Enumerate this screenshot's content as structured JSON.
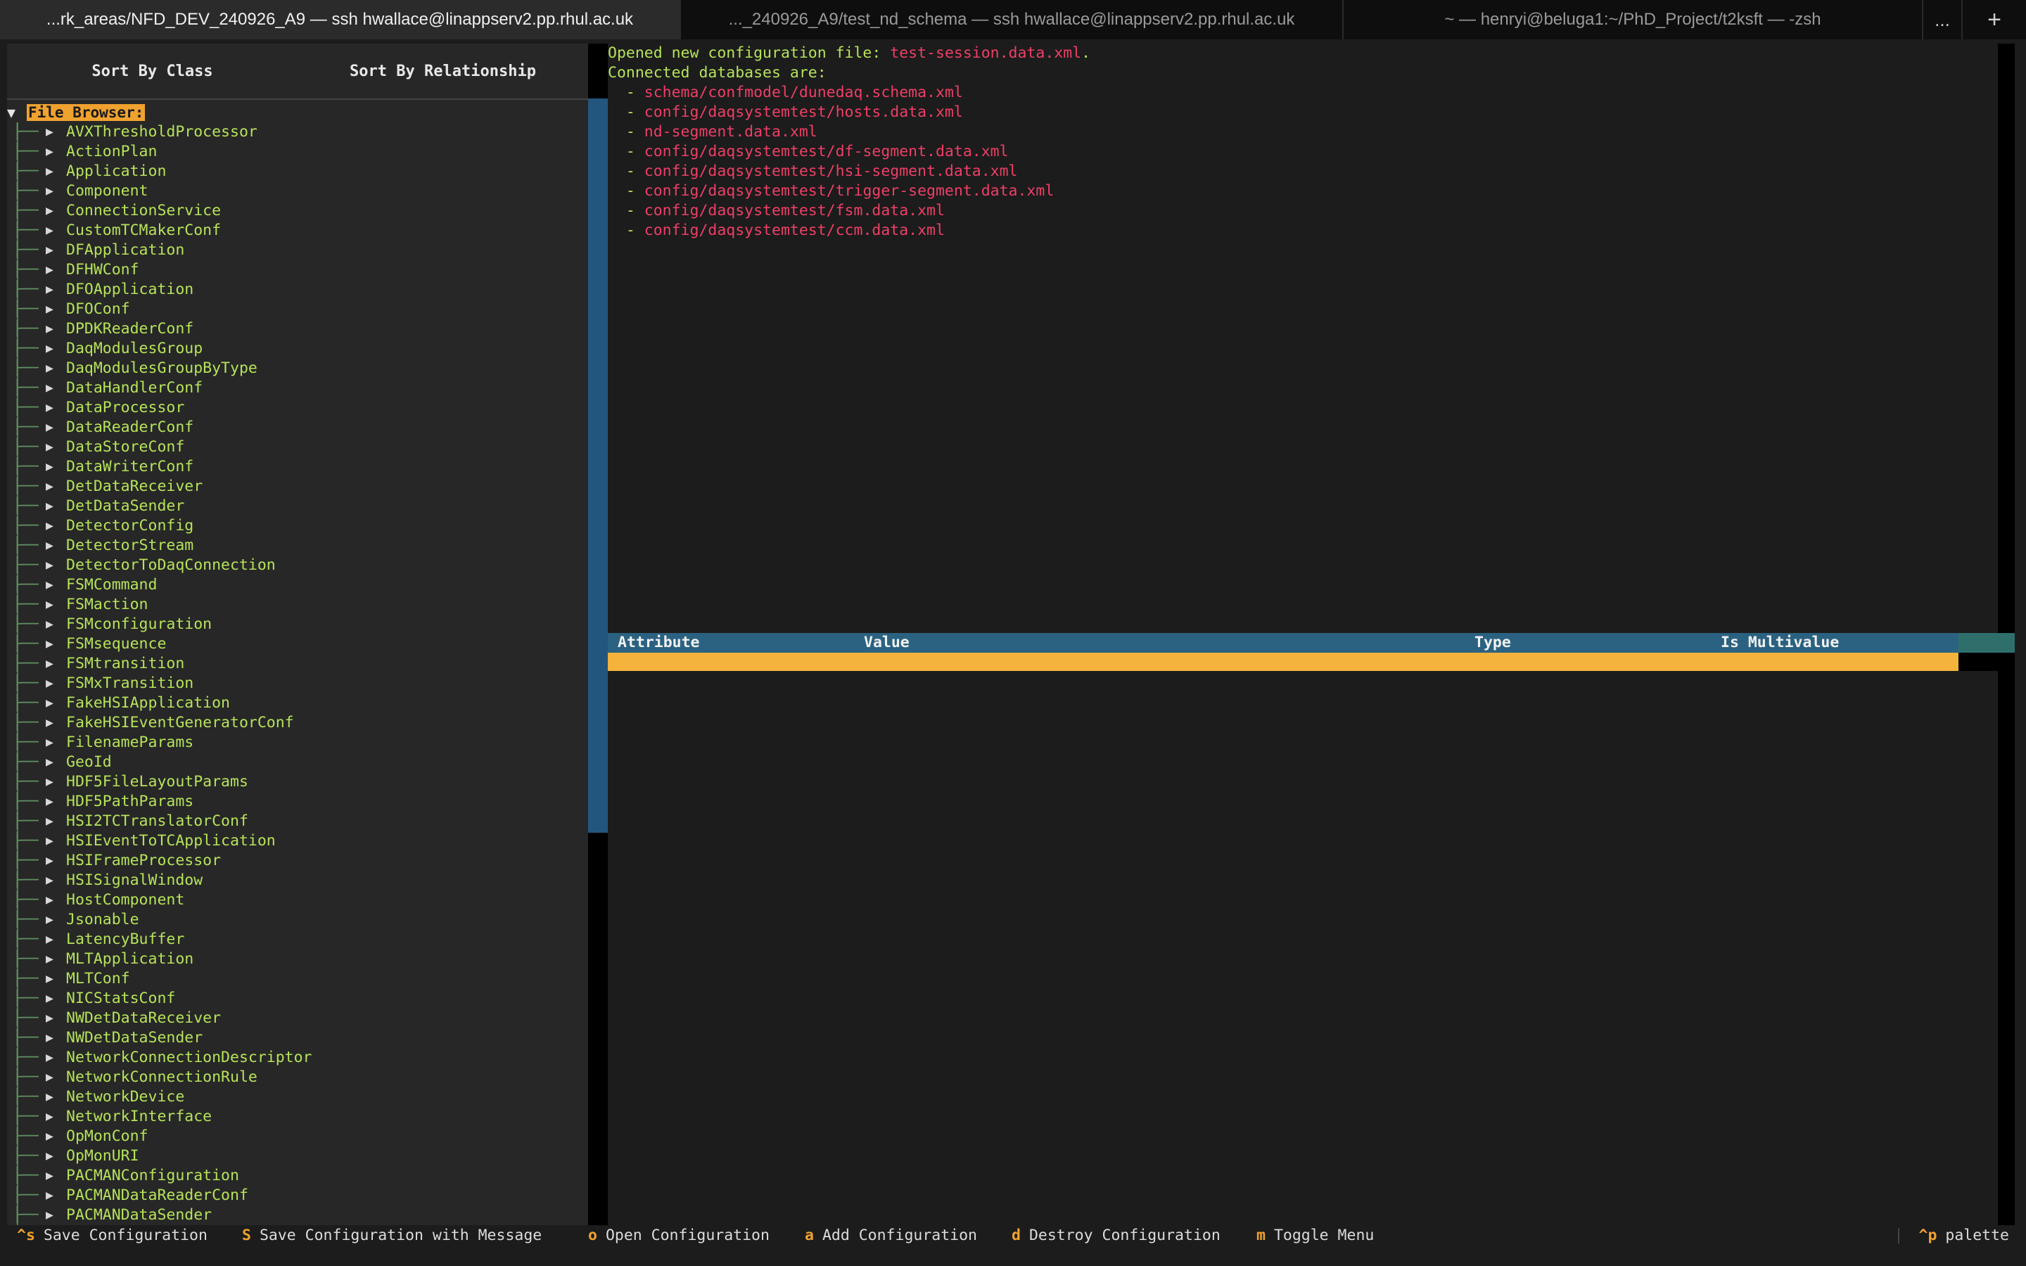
{
  "tabs": [
    {
      "title": "...rk_areas/NFD_DEV_240926_A9 — ssh hwallace@linappserv2.pp.rhul.ac.uk",
      "active": true
    },
    {
      "title": "..._240926_A9/test_nd_schema — ssh hwallace@linappserv2.pp.rhul.ac.uk",
      "active": false
    },
    {
      "title": "~ — henryi@beluga1:~/PhD_Project/t2ksft — -zsh",
      "active": false
    }
  ],
  "tab_more": "...",
  "tab_plus": "+",
  "sort": {
    "by_class": "Sort By Class",
    "by_relationship": "Sort By Relationship"
  },
  "tree": {
    "root_label": "File Browser:",
    "classes": [
      "AVXThresholdProcessor",
      "ActionPlan",
      "Application",
      "Component",
      "ConnectionService",
      "CustomTCMakerConf",
      "DFApplication",
      "DFHWConf",
      "DFOApplication",
      "DFOConf",
      "DPDKReaderConf",
      "DaqModulesGroup",
      "DaqModulesGroupByType",
      "DataHandlerConf",
      "DataProcessor",
      "DataReaderConf",
      "DataStoreConf",
      "DataWriterConf",
      "DetDataReceiver",
      "DetDataSender",
      "DetectorConfig",
      "DetectorStream",
      "DetectorToDaqConnection",
      "FSMCommand",
      "FSMaction",
      "FSMconfiguration",
      "FSMsequence",
      "FSMtransition",
      "FSMxTransition",
      "FakeHSIApplication",
      "FakeHSIEventGeneratorConf",
      "FilenameParams",
      "GeoId",
      "HDF5FileLayoutParams",
      "HDF5PathParams",
      "HSI2TCTranslatorConf",
      "HSIEventToTCApplication",
      "HSIFrameProcessor",
      "HSISignalWindow",
      "HostComponent",
      "Jsonable",
      "LatencyBuffer",
      "MLTApplication",
      "MLTConf",
      "NICStatsConf",
      "NWDetDataReceiver",
      "NWDetDataSender",
      "NetworkConnectionDescriptor",
      "NetworkConnectionRule",
      "NetworkDevice",
      "NetworkInterface",
      "OpMonConf",
      "OpMonURI",
      "PACMANConfiguration",
      "PACMANDataReaderConf",
      "PACMANDataSender"
    ]
  },
  "log": {
    "opened_prefix": "Opened new configuration file: ",
    "opened_file": "test-session.data.xml",
    "opened_suffix": ".",
    "connected_label": "Connected databases are:",
    "bullet": "  - ",
    "databases": [
      "schema/confmodel/dunedaq.schema.xml",
      "config/daqsystemtest/hosts.data.xml",
      "nd-segment.data.xml",
      "config/daqsystemtest/df-segment.data.xml",
      "config/daqsystemtest/hsi-segment.data.xml",
      "config/daqsystemtest/trigger-segment.data.xml",
      "config/daqsystemtest/fsm.data.xml",
      "config/daqsystemtest/ccm.data.xml"
    ]
  },
  "attr_table": {
    "columns": [
      "Attribute",
      "Value",
      "Type",
      "Is Multivalue"
    ]
  },
  "footer": {
    "keys": [
      {
        "key": "^s",
        "label": "Save Configuration"
      },
      {
        "key": "S",
        "label": "Save Configuration with Message"
      },
      {
        "key": "o",
        "label": "Open Configuration"
      },
      {
        "key": "a",
        "label": "Add Configuration"
      },
      {
        "key": "d",
        "label": "Destroy Configuration"
      },
      {
        "key": "m",
        "label": "Toggle Menu"
      }
    ],
    "palette_key": "^p",
    "palette_label": "palette"
  },
  "colors": {
    "accent_orange": "#f0a22f",
    "class_green": "#b6e35a",
    "file_red": "#ee3f66",
    "header_blue": "#2b6281"
  }
}
